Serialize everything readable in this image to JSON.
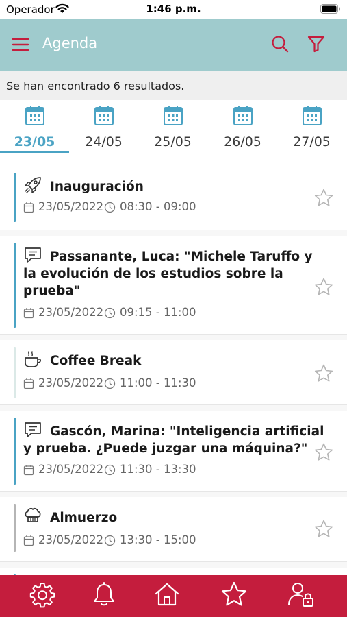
{
  "status_bar": {
    "carrier": "Operador",
    "time": "1:46 p.m."
  },
  "header": {
    "title": "Agenda",
    "bg_color": "#9fcbcd",
    "accent_color": "#c41d3d",
    "icons": [
      "menu-icon",
      "search-icon",
      "filter-icon"
    ]
  },
  "results": {
    "text": "Se han encontrado 6 resultados."
  },
  "date_tabs": [
    {
      "label": "23/05",
      "active": true
    },
    {
      "label": "24/05",
      "active": false
    },
    {
      "label": "25/05",
      "active": false
    },
    {
      "label": "26/05",
      "active": false
    },
    {
      "label": "27/05",
      "active": false
    }
  ],
  "agenda": [
    {
      "icon": "rocket-icon",
      "title": "Inauguración",
      "date": "23/05/2022",
      "time": "08:30 - 09:00",
      "accent_color": "#4aa3c4"
    },
    {
      "icon": "speech-bubble-icon",
      "title_lines": [
        "Passanante, Luca: \"Michele Taruffo y",
        "la evolución de los estudios sobre la",
        "prueba\""
      ],
      "date": "23/05/2022",
      "time": "09:15 - 11:00",
      "accent_color": "#4aa3c4"
    },
    {
      "icon": "coffee-cup-icon",
      "title": "Coffee Break",
      "date": "23/05/2022",
      "time": "11:00 - 11:30",
      "accent_color": "#dbe9e7"
    },
    {
      "icon": "speech-bubble-icon",
      "title_lines": [
        "Gascón, Marina: \"Inteligencia artificial",
        "y prueba. ¿Puede juzgar una máquina?\""
      ],
      "date": "23/05/2022",
      "time": "11:30 - 13:30",
      "accent_color": "#4aa3c4"
    },
    {
      "icon": "chef-hat-icon",
      "title": "Almuerzo",
      "date": "23/05/2022",
      "time": "13:30 - 15:00",
      "accent_color": "#b5b5b5"
    }
  ],
  "bottom_nav": {
    "bg_color": "#c41d3d",
    "items": [
      "settings-icon",
      "bell-icon",
      "home-icon",
      "star-icon",
      "user-lock-icon"
    ]
  }
}
